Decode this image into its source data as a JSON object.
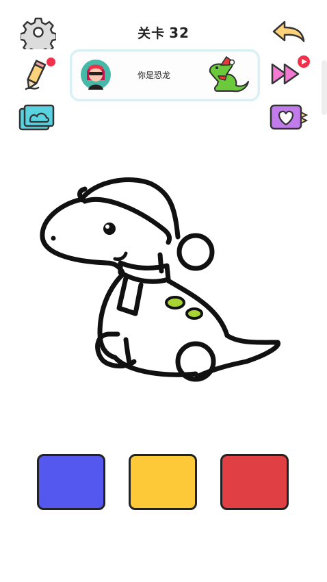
{
  "header": {
    "level_label": "关卡",
    "level_number": "32"
  },
  "banner": {
    "prompt": "你是恐龙"
  },
  "toolbar": {
    "settings_icon": "gear-icon",
    "back_icon": "undo-arrow-icon",
    "hint_icon": "pencil-icon",
    "skip_icon": "fast-forward-icon",
    "gallery_icon": "photo-stack-icon",
    "favorite_icon": "heart-card-icon"
  },
  "palette": {
    "colors": [
      "#5558ee",
      "#fdc938",
      "#e04043"
    ]
  },
  "colors": {
    "accent_yellow": "#fdd27a",
    "skip_pink": "#f27ad2",
    "gallery_blue": "#5ad2e0",
    "favorite_purple": "#c27bea",
    "dino_spots": "#a7d433"
  }
}
